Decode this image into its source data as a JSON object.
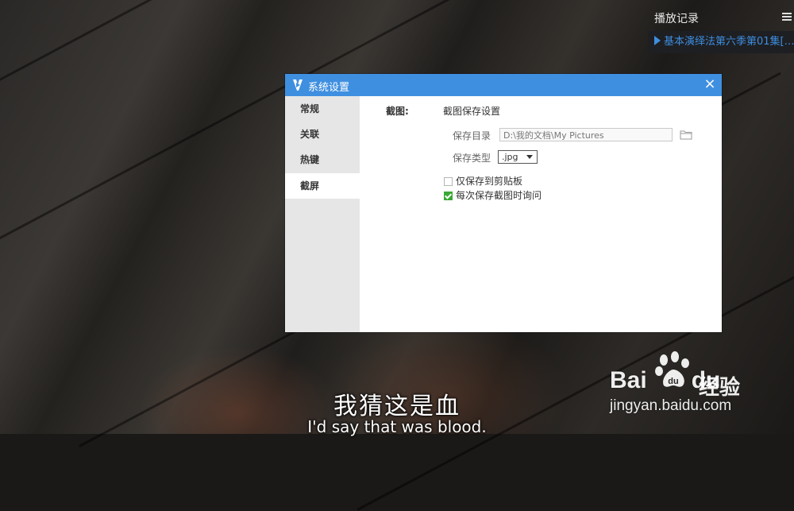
{
  "history": {
    "title": "播放记录",
    "menu_icon": "list-menu-icon",
    "items": [
      {
        "label": "基本演绎法第六季第01集[…",
        "icon": "play-icon",
        "color": "#3d8ee0"
      }
    ]
  },
  "dialog": {
    "title": "系统设置",
    "logo_icon": "player-logo-icon",
    "close_icon": "close-icon",
    "accent": "#3f8fe0",
    "nav": [
      {
        "label": "常规",
        "active": false
      },
      {
        "label": "关联",
        "active": false
      },
      {
        "label": "热键",
        "active": false
      },
      {
        "label": "截屏",
        "active": true
      }
    ],
    "screenshot": {
      "section_label": "截图:",
      "section_title": "截图保存设置",
      "save_dir_label": "保存目录",
      "save_dir_value": "D:\\我的文档\\My Pictures",
      "folder_icon": "folder-icon",
      "save_type_label": "保存类型",
      "save_type_value": ".jpg",
      "options": [
        {
          "label": "仅保存到剪贴板",
          "checked": false
        },
        {
          "label": "每次保存截图时询问",
          "checked": true,
          "color": "#3aa835"
        }
      ]
    }
  },
  "subtitles": {
    "chinese": "我猜这是血",
    "english": "I'd say that was blood."
  },
  "watermark": {
    "logo_left": "Bai",
    "logo_right": "du",
    "logo_cn": "经验",
    "url": "jingyan.baidu.com",
    "paw_icon": "baidu-paw-icon"
  }
}
